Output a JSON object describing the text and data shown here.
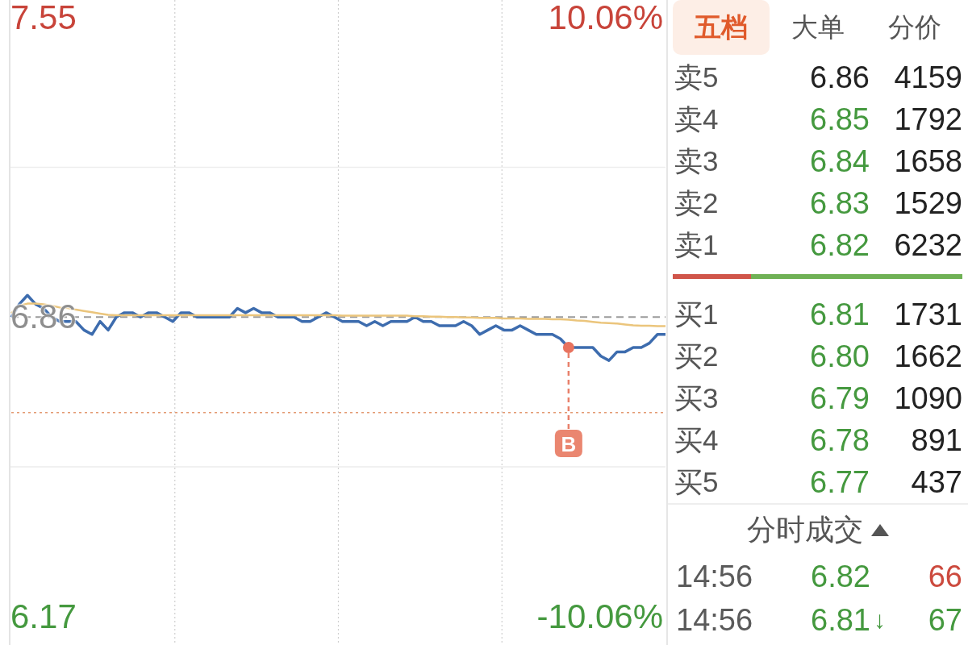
{
  "chart": {
    "chart_data": [
      {
        "type": "line",
        "ylim": [
          6.105,
          7.59
        ],
        "yticks": [
          7.55,
          6.86,
          6.17
        ],
        "y2lim": [
          -11.01,
          10.64
        ],
        "y2ticks": [
          {
            "value": 10.06,
            "label": "10.06%"
          },
          {
            "value": -10.06,
            "label": "-10.06%"
          }
        ],
        "grid": true,
        "series": [
          {
            "color": "#3d6cae",
            "values": [
              6.86,
              6.89,
              6.91,
              6.89,
              6.88,
              6.86,
              6.85,
              6.85,
              6.85,
              6.83,
              6.82,
              6.85,
              6.83,
              6.86,
              6.87,
              6.87,
              6.86,
              6.87,
              6.87,
              6.86,
              6.85,
              6.87,
              6.87,
              6.86,
              6.86,
              6.86,
              6.86,
              6.86,
              6.88,
              6.87,
              6.88,
              6.87,
              6.87,
              6.86,
              6.86,
              6.86,
              6.85,
              6.85,
              6.86,
              6.87,
              6.86,
              6.85,
              6.85,
              6.85,
              6.84,
              6.85,
              6.84,
              6.85,
              6.85,
              6.85,
              6.86,
              6.85,
              6.85,
              6.84,
              6.84,
              6.84,
              6.85,
              6.84,
              6.82,
              6.83,
              6.84,
              6.83,
              6.83,
              6.84,
              6.83,
              6.82,
              6.82,
              6.82,
              6.81,
              6.79,
              6.79,
              6.79,
              6.79,
              6.77,
              6.76,
              6.78,
              6.78,
              6.79,
              6.79,
              6.8,
              6.82,
              6.82
            ]
          },
          {
            "color": "#ebc57c",
            "values": [
              6.869,
              6.886,
              6.891,
              6.891,
              6.889,
              6.886,
              6.882,
              6.881,
              6.877,
              6.874,
              6.871,
              6.868,
              6.865,
              6.864,
              6.864,
              6.864,
              6.864,
              6.864,
              6.864,
              6.864,
              6.864,
              6.864,
              6.864,
              6.864,
              6.864,
              6.864,
              6.864,
              6.864,
              6.864,
              6.864,
              6.864,
              6.864,
              6.864,
              6.864,
              6.864,
              6.864,
              6.864,
              6.864,
              6.864,
              6.864,
              6.864,
              6.863,
              6.863,
              6.863,
              6.863,
              6.863,
              6.863,
              6.863,
              6.863,
              6.863,
              6.862,
              6.862,
              6.861,
              6.861,
              6.86,
              6.86,
              6.859,
              6.859,
              6.858,
              6.858,
              6.858,
              6.857,
              6.857,
              6.857,
              6.856,
              6.856,
              6.856,
              6.855,
              6.855,
              6.854,
              6.852,
              6.851,
              6.849,
              6.847,
              6.846,
              6.845,
              6.843,
              6.841,
              6.84,
              6.84,
              6.839,
              6.839
            ]
          }
        ],
        "ref_lines": [
          {
            "axis": "y",
            "value": 7.205,
            "color": "#ededed",
            "line_style": "solid"
          },
          {
            "axis": "y",
            "value": 6.86,
            "color": "#9a9a9a",
            "line_style": "dashed"
          },
          {
            "axis": "y",
            "value": 6.64,
            "color": "#e39a72",
            "line_style": "dotted"
          },
          {
            "axis": "y",
            "value": 6.515,
            "color": "#ededed",
            "line_style": "solid"
          }
        ],
        "annotations": [
          "B"
        ]
      }
    ]
  },
  "order_book": {
    "tabs": [
      {
        "label": "五档",
        "selected": true
      },
      {
        "label": "大单",
        "selected": false
      },
      {
        "label": "分价",
        "selected": false
      }
    ],
    "asks": [
      {
        "label": "卖5",
        "price": "6.86",
        "down": false,
        "volume": "4159"
      },
      {
        "label": "卖4",
        "price": "6.85",
        "down": true,
        "volume": "1792"
      },
      {
        "label": "卖3",
        "price": "6.84",
        "down": true,
        "volume": "1658"
      },
      {
        "label": "卖2",
        "price": "6.83",
        "down": true,
        "volume": "1529"
      },
      {
        "label": "卖1",
        "price": "6.82",
        "down": true,
        "volume": "6232"
      }
    ],
    "ratio_bar": {
      "level": 0.27
    },
    "bids": [
      {
        "label": "买1",
        "price": "6.81",
        "down": true,
        "volume": "1731"
      },
      {
        "label": "买2",
        "price": "6.80",
        "down": true,
        "volume": "1662"
      },
      {
        "label": "买3",
        "price": "6.79",
        "down": true,
        "volume": "1090"
      },
      {
        "label": "买4",
        "price": "6.78",
        "down": true,
        "volume": "891"
      },
      {
        "label": "买5",
        "price": "6.77",
        "down": true,
        "volume": "437"
      }
    ]
  },
  "trades": {
    "title": "分时成交",
    "rows": [
      {
        "time": "14:56",
        "price": "6.82",
        "down": true,
        "volume": "66",
        "buy": true
      },
      {
        "time": "14:56",
        "price": "6.81",
        "arrow": "↓",
        "down": true,
        "volume": "67",
        "buy": false
      }
    ]
  }
}
